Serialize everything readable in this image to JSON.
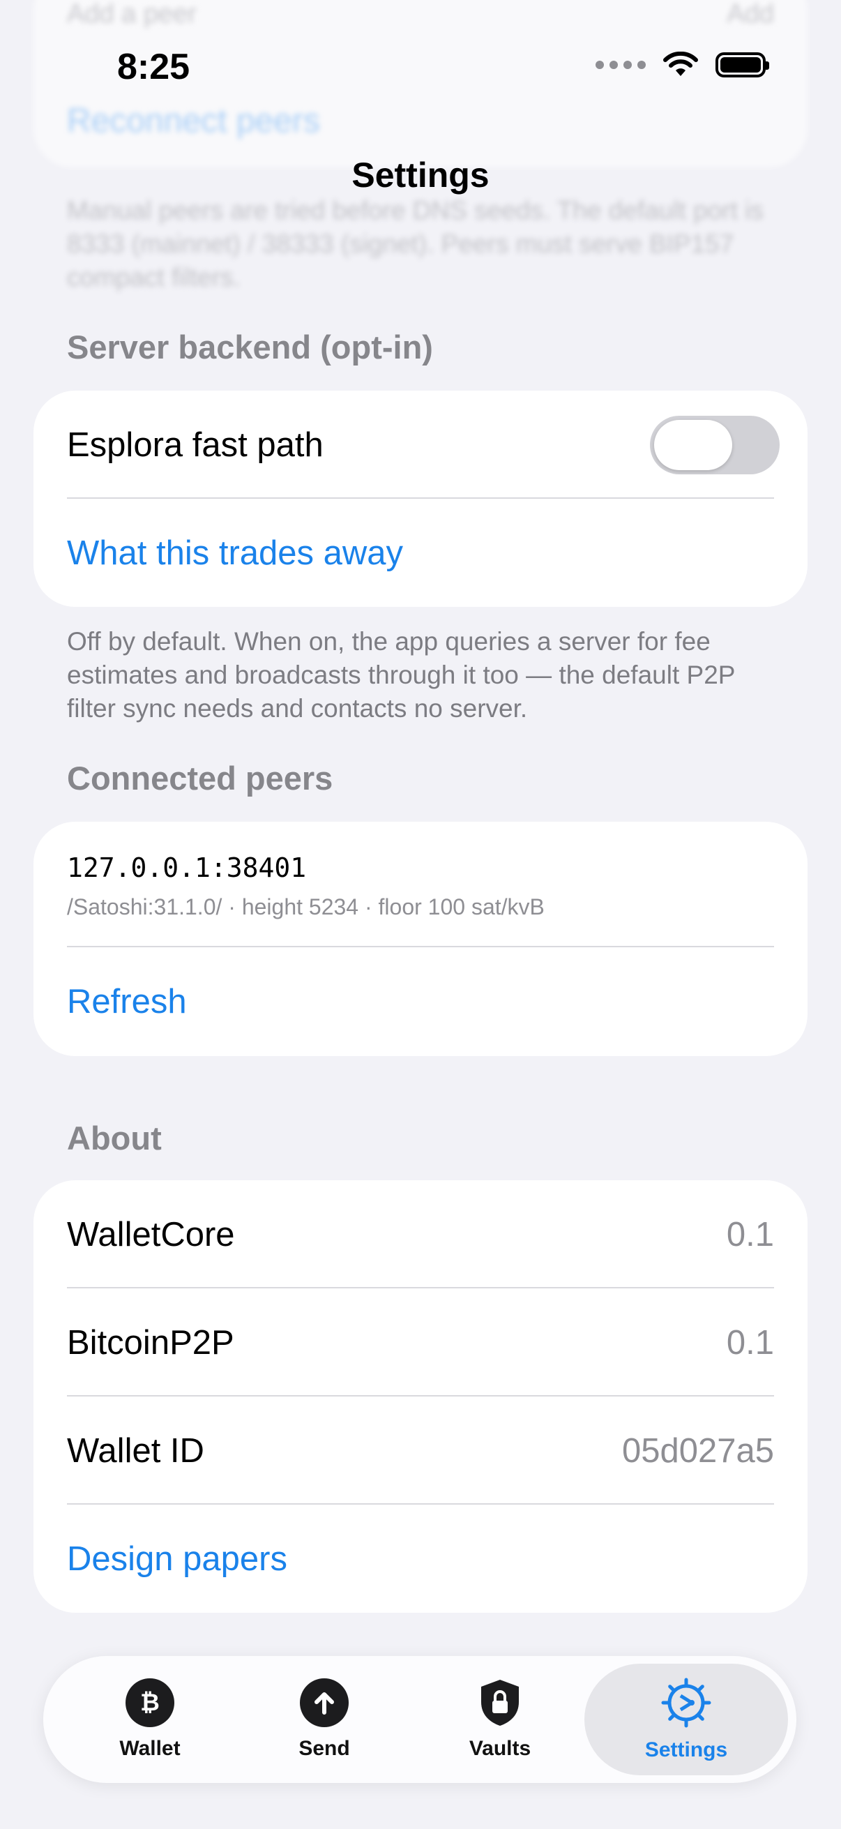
{
  "background_ghost": {
    "row_label": "Add a peer",
    "row_action": "Add",
    "reconnect": "Reconnect peers",
    "note": "Manual peers are tried before DNS seeds. The default port is 8333 (mainnet) / 38333 (signet). Peers must serve BIP157 compact filters."
  },
  "status_bar": {
    "time": "8:25"
  },
  "nav": {
    "title": "Settings"
  },
  "server_backend": {
    "header": "Server backend (opt-in)",
    "esplora_label": "Esplora fast path",
    "esplora_enabled": false,
    "tradeoff_link": "What this trades away",
    "footnote": "Off by default. When on, the app queries a server for fee estimates and broadcasts through it too — the default P2P filter sync needs and contacts no server."
  },
  "connected_peers": {
    "header": "Connected peers",
    "peers": [
      {
        "address": "127.0.0.1:38401",
        "detail": "/Satoshi:31.1.0/ · height 5234 · floor 100 sat/kvB"
      }
    ],
    "refresh": "Refresh"
  },
  "about": {
    "header": "About",
    "rows": [
      {
        "label": "WalletCore",
        "value": "0.1"
      },
      {
        "label": "BitcoinP2P",
        "value": "0.1"
      },
      {
        "label": "Wallet ID",
        "value": "05d027a5"
      }
    ],
    "design_papers": "Design papers"
  },
  "tabbar": {
    "tabs": [
      {
        "label": "Wallet",
        "icon": "bitcoin-icon"
      },
      {
        "label": "Send",
        "icon": "arrow-up-icon"
      },
      {
        "label": "Vaults",
        "icon": "lock-shield-icon"
      },
      {
        "label": "Settings",
        "icon": "gear-icon"
      }
    ],
    "active_index": 3
  },
  "colors": {
    "accent": "#1a82ea",
    "background": "#f2f2f7",
    "card": "#ffffff"
  }
}
